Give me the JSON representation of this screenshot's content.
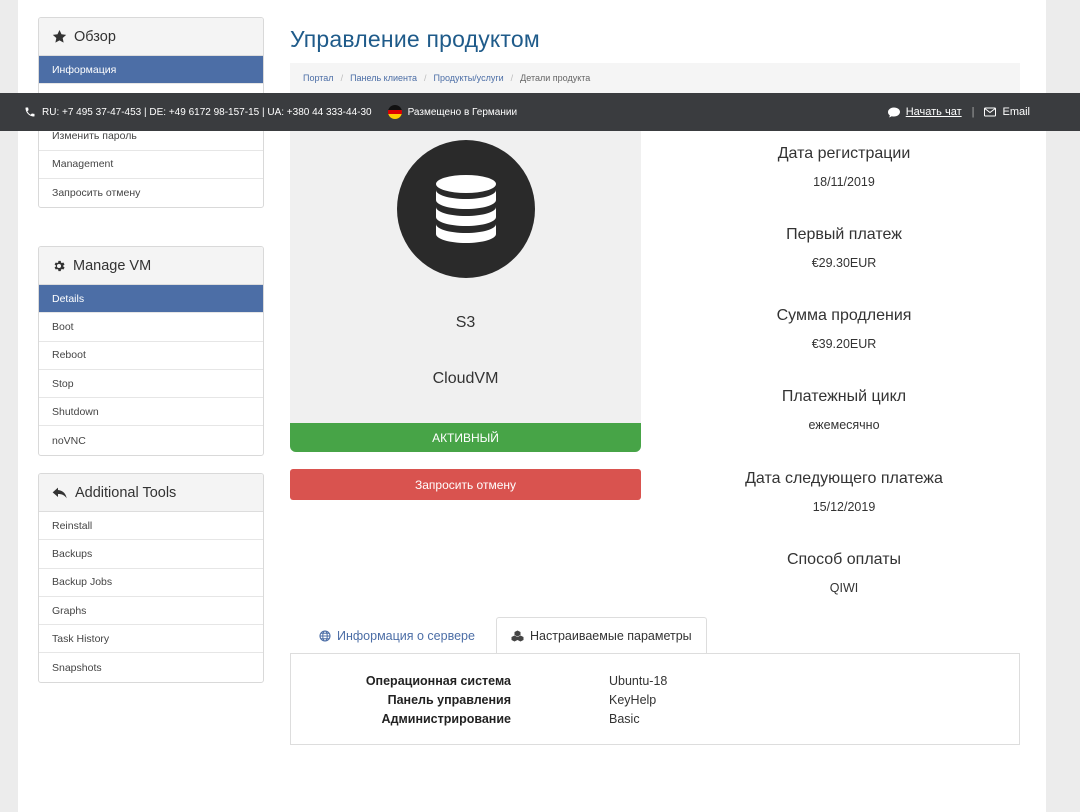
{
  "sidebar": {
    "overview": {
      "title": "Обзор",
      "active_item": "Информация",
      "items": [
        "Изменить пароль",
        "Management",
        "Запросить отмену"
      ]
    },
    "manage_vm": {
      "title": "Manage VM",
      "items": [
        "Details",
        "Boot",
        "Reboot",
        "Stop",
        "Shutdown",
        "noVNC"
      ]
    },
    "tools": {
      "title": "Additional Tools",
      "items": [
        "Reinstall",
        "Backups",
        "Backup Jobs",
        "Graphs",
        "Task History",
        "Snapshots"
      ]
    }
  },
  "header": {
    "title": "Управление продуктом",
    "breadcrumb": [
      "Портал",
      "Панель клиента",
      "Продукты/услуги",
      "Детали продукта"
    ]
  },
  "topbar": {
    "phones": "RU: +7 495 37-47-453 | DE: +49 6172 98-157-15 | UA: +380 44 333-44-30",
    "hosted": "Размещено в Германии",
    "chat": "Начать чат",
    "email": "Email"
  },
  "product": {
    "name": "S3",
    "group": "CloudVM",
    "status": "АКТИВНЫЙ",
    "cancel_label": "Запросить отмену"
  },
  "info": [
    {
      "label": "Дата регистрации",
      "value": "18/11/2019"
    },
    {
      "label": "Первый платеж",
      "value": "€29.30EUR"
    },
    {
      "label": "Сумма продления",
      "value": "€39.20EUR"
    },
    {
      "label": "Платежный цикл",
      "value": "ежемесячно"
    },
    {
      "label": "Дата следующего платежа",
      "value": "15/12/2019"
    },
    {
      "label": "Способ оплаты",
      "value": "QIWI"
    }
  ],
  "tabs": {
    "server_info": "Информация о сервере",
    "config": "Настраиваемые параметры"
  },
  "config_rows": [
    {
      "key": "Операционная система",
      "value": "Ubuntu-18"
    },
    {
      "key": "Панель управления",
      "value": "KeyHelp"
    },
    {
      "key": "Администрирование",
      "value": "Basic"
    }
  ],
  "colors": {
    "accent": "#4c6ea6",
    "title": "#1f5b8a",
    "active_status": "#47a447",
    "danger": "#d9534f",
    "topbar": "#3a3c3f"
  }
}
